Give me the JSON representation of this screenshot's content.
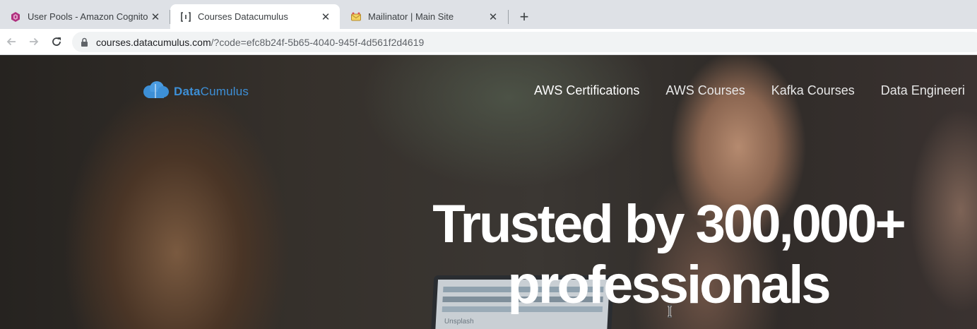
{
  "browser": {
    "tabs": [
      {
        "title": "User Pools - Amazon Cognito",
        "icon": "cognito-icon",
        "active": false
      },
      {
        "title": "Courses Datacumulus",
        "icon": "bracket-page-icon",
        "active": true
      },
      {
        "title": "Mailinator | Main Site",
        "icon": "mailinator-icon",
        "active": false
      }
    ],
    "new_tab_label": "+",
    "close_glyph": "✕",
    "url_host": "courses.datacumulus.com",
    "url_path": "/?code=efc8b24f-5b65-4040-945f-4d561f2d4619"
  },
  "site": {
    "logo": {
      "part1": "Data",
      "part2": "Cumulus"
    },
    "nav": [
      "AWS Certifications",
      "AWS Courses",
      "Kafka Courses",
      "Data Engineeri"
    ],
    "hero": {
      "line1": "Trusted by 300,000+",
      "line2": "professionals"
    },
    "laptop_text": "Unsplash"
  },
  "colors": {
    "brand_blue": "#3d8fd6",
    "tab_active": "#ffffff",
    "tabstrip": "#dee1e6"
  }
}
